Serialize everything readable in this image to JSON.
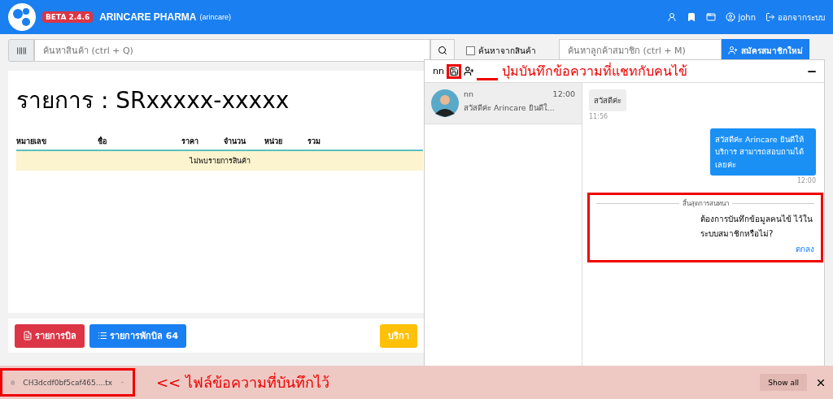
{
  "header": {
    "badge": "BETA 2.4.6",
    "title": "ARINCARE PHARMA",
    "subtitle": "(arincare)",
    "user": "john",
    "logout": "ออกจากระบบ"
  },
  "toolbar": {
    "product_search": {
      "placeholder": "ค้นหาสินค้า (ctrl + Q)"
    },
    "product_checkbox": {
      "label": "ค้นหาจากสินค้า",
      "checked": false
    },
    "member_search": {
      "placeholder": "ค้นหาลูกค้าสมาชิก (ctrl + M)"
    },
    "register_button": "สมัครสมาชิกใหม่"
  },
  "order": {
    "title": "รายการ : SRxxxxx-xxxxx",
    "columns": [
      "หมายเลข",
      "ชื่อ",
      "ราคา",
      "จำนวน",
      "หน่วย",
      "รวม"
    ],
    "empty_text": "ไม่พบรายการสินค้า",
    "buttons": [
      {
        "label": "รายการบิล",
        "kind": "danger"
      },
      {
        "label": "รายการพักบิล 64",
        "kind": "primary"
      },
      {
        "label": "บริกา",
        "kind": "warning"
      }
    ]
  },
  "chat": {
    "name": "nn",
    "contacts": [
      {
        "name": "nn",
        "time": "12:00",
        "preview": "สวัสดีค่ะ Arincare ยินดีใ...",
        "selected": true
      }
    ],
    "messages": [
      {
        "kind": "incoming",
        "text": "สวัสดีค่ะ",
        "time": "11:56"
      },
      {
        "kind": "outgoing",
        "text": "สวัสดีค่ะ Arincare ยินดีให้บริการ สามารถสอบถามได้เลยค่ะ",
        "time": "12:00"
      }
    ],
    "end_notice": {
      "divider": "สิ้นสุดการสนทนา",
      "question": "ต้องการบันทึกข้อมูลคนไข้ ไว้ในระบบสมาชิกหรือไม่?",
      "action": "ตกลง"
    }
  },
  "downloads": {
    "file": "CH3dcdf0bf5caf465....tx",
    "show_all": "Show all"
  },
  "annotations": {
    "save_note": "ปุ่มบันทึกข้อความที่แชทกับคนไข้",
    "file_note": "<< ไฟล์ข้อความที่บันทึกไว้"
  }
}
